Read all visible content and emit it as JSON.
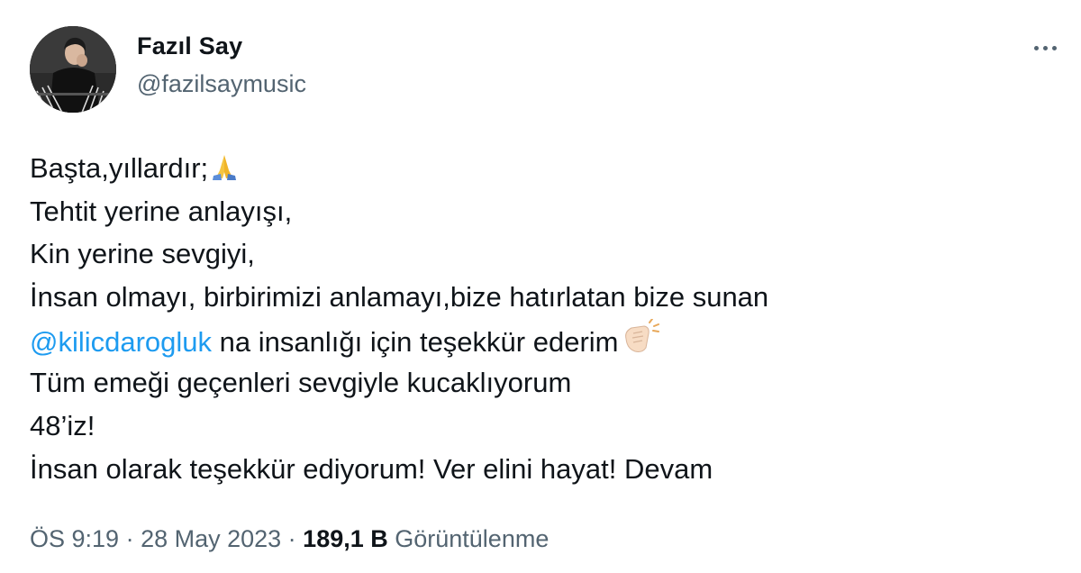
{
  "author": {
    "display_name": "Fazıl Say",
    "handle": "@fazilsaymusic",
    "avatar_icon": "profile-photo-pianist"
  },
  "more_icon": "more-horizontal-icon",
  "tweet": {
    "lines": [
      {
        "text": "Başta,yıllardır;",
        "emoji": "folded-hands-emoji"
      },
      {
        "text": "Tehtit yerine anlayışı,"
      },
      {
        "text": "Kin yerine sevgiyi,"
      },
      {
        "text": "İnsan olmayı, birbirimizi anlamayı,bize hatırlatan bize sunan"
      },
      {
        "mention": "@kilicdarogluk",
        "text": " na insanlığı için teşekkür ederim",
        "emoji": "clapping-hands-emoji"
      },
      {
        "text": "Tüm emeği geçenleri sevgiyle kucaklıyorum"
      },
      {
        "text": "48’iz!"
      },
      {
        "text": "İnsan olarak teşekkür ediyorum! Ver elini hayat! Devam"
      }
    ]
  },
  "meta": {
    "time": "ÖS 9:19",
    "separator": " · ",
    "date": "28 May 2023",
    "separator2": " · ",
    "views_count": "189,1 B",
    "views_label": " Görüntülenme"
  },
  "colors": {
    "text": "#0f1419",
    "secondary": "#536471",
    "link": "#1d9bf0",
    "background": "#ffffff"
  }
}
